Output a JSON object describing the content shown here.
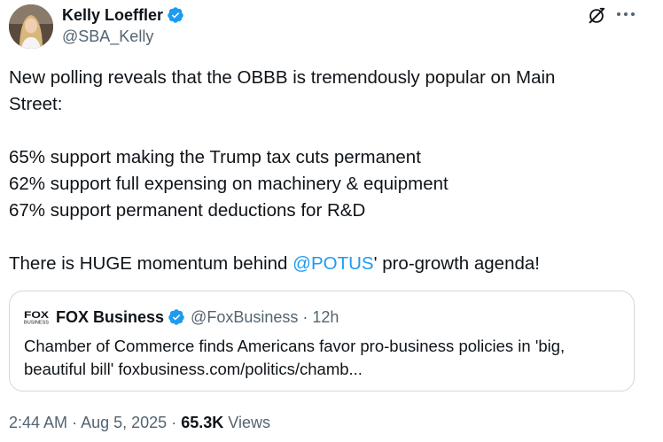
{
  "author": {
    "name": "Kelly Loeffler",
    "handle": "@SBA_Kelly"
  },
  "tweet": {
    "lines": [
      "New polling reveals that the OBBB is tremendously popular on Main",
      "Street:",
      "",
      "65% support making the Trump tax cuts permanent",
      "62% support full expensing on machinery & equipment",
      "67% support permanent deductions for R&D",
      ""
    ],
    "last_line_prefix": "There is HUGE momentum behind ",
    "mention": "@POTUS",
    "last_line_suffix": "' pro-growth agenda!"
  },
  "quote": {
    "logo_text": "FOX BUSINESS",
    "name": "FOX Business",
    "handle": "@FoxBusiness",
    "separator": "·",
    "time": "12h",
    "text_line1": "Chamber of Commerce finds Americans favor pro-business policies in 'big,",
    "text_line2": "beautiful bill' foxbusiness.com/politics/chamb..."
  },
  "meta": {
    "time": "2:44 AM",
    "sep1": "·",
    "date": "Aug 5, 2025",
    "sep2": "·",
    "views_count": "65.3K",
    "views_label": "Views"
  },
  "colors": {
    "accent": "#1d9bf0",
    "text": "#0f1419",
    "secondary": "#536471",
    "border": "#cfd9de"
  },
  "icons": {
    "verified": "verified-badge-icon",
    "grok": "grok-icon",
    "more": "more-icon"
  }
}
